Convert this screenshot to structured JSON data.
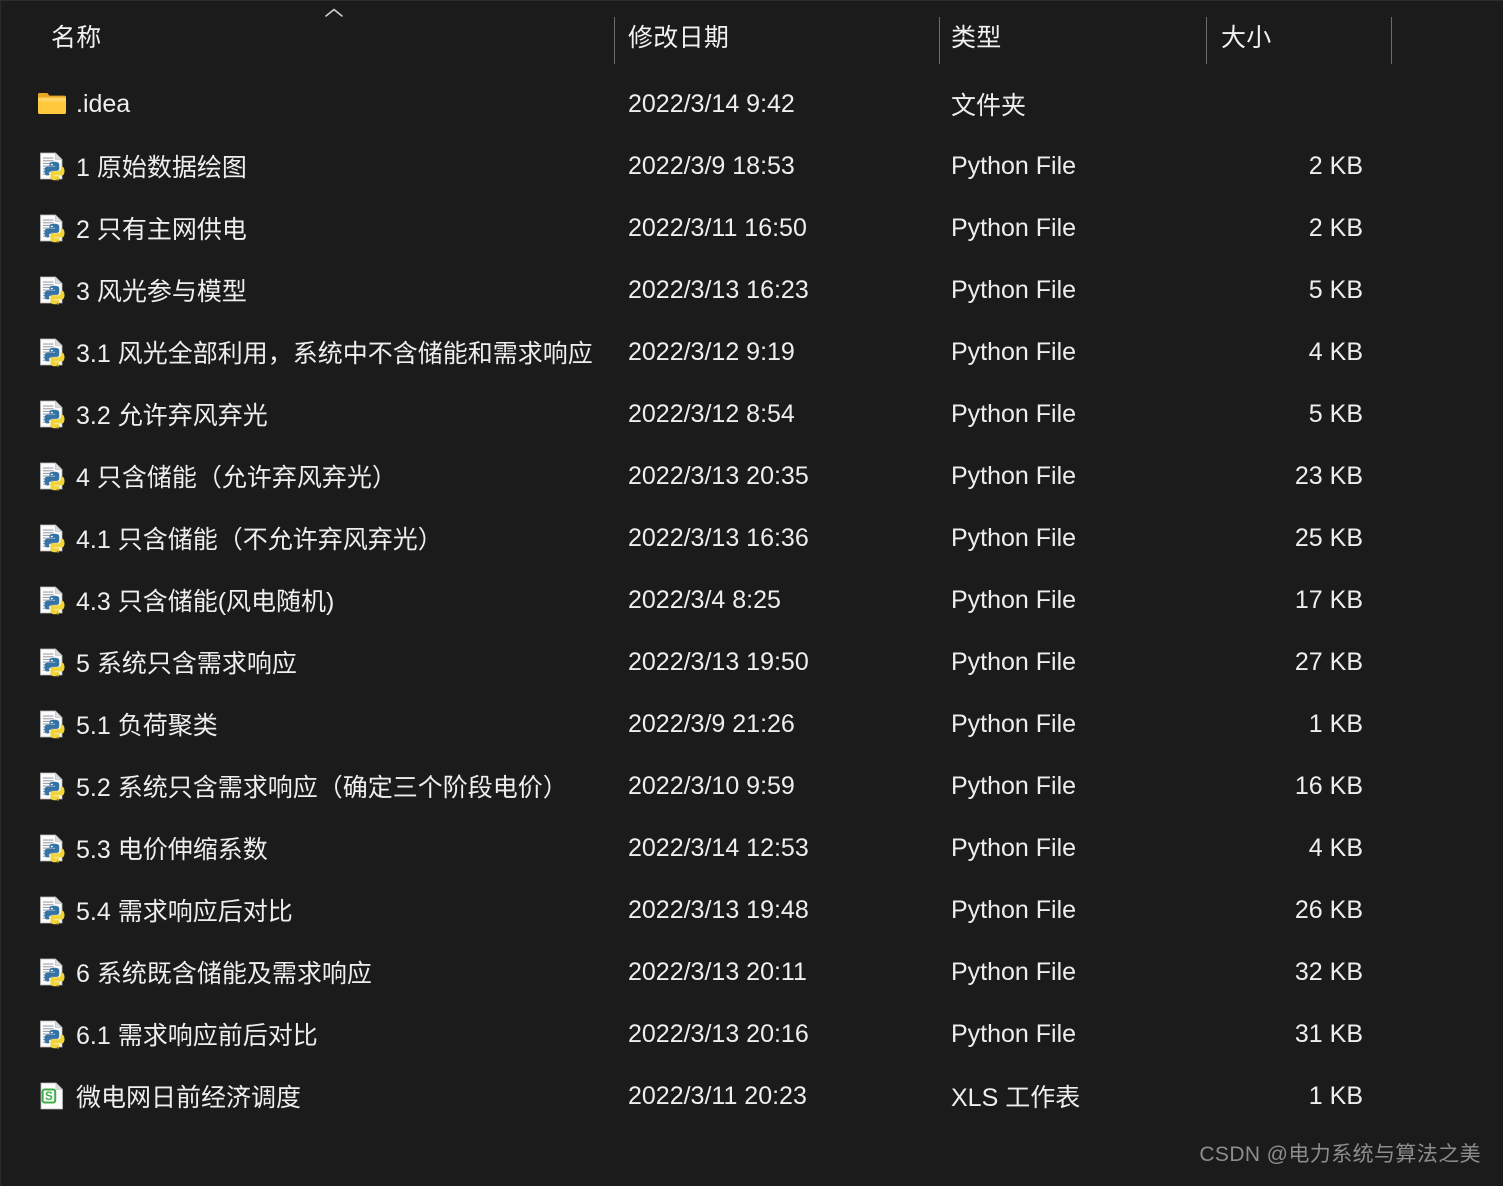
{
  "columns": {
    "name": "名称",
    "date_modified": "修改日期",
    "type": "类型",
    "size": "大小"
  },
  "sort": {
    "column": "名称",
    "direction": "ascending",
    "indicator_icon": "chevron-up-icon"
  },
  "colors": {
    "background": "#1b1b1b",
    "text": "#eeeeee",
    "divider": "#6d6d6d",
    "folder": "#ffc83d",
    "python_blue": "#366f9d",
    "python_yellow": "#f0d43a",
    "xls_green": "#3fae4a",
    "watermark": "#8d8d8d"
  },
  "rows": [
    {
      "icon": "folder-icon",
      "name": ".idea",
      "date": "2022/3/14 9:42",
      "type": "文件夹",
      "size": ""
    },
    {
      "icon": "python-file-icon",
      "name": "1 原始数据绘图",
      "date": "2022/3/9 18:53",
      "type": "Python File",
      "size": "2 KB"
    },
    {
      "icon": "python-file-icon",
      "name": "2 只有主网供电",
      "date": "2022/3/11 16:50",
      "type": "Python File",
      "size": "2 KB"
    },
    {
      "icon": "python-file-icon",
      "name": "3 风光参与模型",
      "date": "2022/3/13 16:23",
      "type": "Python File",
      "size": "5 KB"
    },
    {
      "icon": "python-file-icon",
      "name": "3.1 风光全部利用，系统中不含储能和需求响应",
      "date": "2022/3/12 9:19",
      "type": "Python File",
      "size": "4 KB"
    },
    {
      "icon": "python-file-icon",
      "name": "3.2 允许弃风弃光",
      "date": "2022/3/12 8:54",
      "type": "Python File",
      "size": "5 KB"
    },
    {
      "icon": "python-file-icon",
      "name": "4 只含储能（允许弃风弃光）",
      "date": "2022/3/13 20:35",
      "type": "Python File",
      "size": "23 KB"
    },
    {
      "icon": "python-file-icon",
      "name": "4.1 只含储能（不允许弃风弃光）",
      "date": "2022/3/13 16:36",
      "type": "Python File",
      "size": "25 KB"
    },
    {
      "icon": "python-file-icon",
      "name": "4.3 只含储能(风电随机)",
      "date": "2022/3/4 8:25",
      "type": "Python File",
      "size": "17 KB"
    },
    {
      "icon": "python-file-icon",
      "name": "5 系统只含需求响应",
      "date": "2022/3/13 19:50",
      "type": "Python File",
      "size": "27 KB"
    },
    {
      "icon": "python-file-icon",
      "name": "5.1 负荷聚类",
      "date": "2022/3/9 21:26",
      "type": "Python File",
      "size": "1 KB"
    },
    {
      "icon": "python-file-icon",
      "name": "5.2 系统只含需求响应（确定三个阶段电价）",
      "date": "2022/3/10 9:59",
      "type": "Python File",
      "size": "16 KB"
    },
    {
      "icon": "python-file-icon",
      "name": "5.3 电价伸缩系数",
      "date": "2022/3/14 12:53",
      "type": "Python File",
      "size": "4 KB"
    },
    {
      "icon": "python-file-icon",
      "name": "5.4 需求响应后对比",
      "date": "2022/3/13 19:48",
      "type": "Python File",
      "size": "26 KB"
    },
    {
      "icon": "python-file-icon",
      "name": "6 系统既含储能及需求响应",
      "date": "2022/3/13 20:11",
      "type": "Python File",
      "size": "32 KB"
    },
    {
      "icon": "python-file-icon",
      "name": "6.1 需求响应前后对比",
      "date": "2022/3/13 20:16",
      "type": "Python File",
      "size": "31 KB"
    },
    {
      "icon": "xls-file-icon",
      "name": "微电网日前经济调度",
      "date": "2022/3/11 20:23",
      "type": "XLS 工作表",
      "size": "1 KB"
    }
  ],
  "watermark": "CSDN @电力系统与算法之美"
}
